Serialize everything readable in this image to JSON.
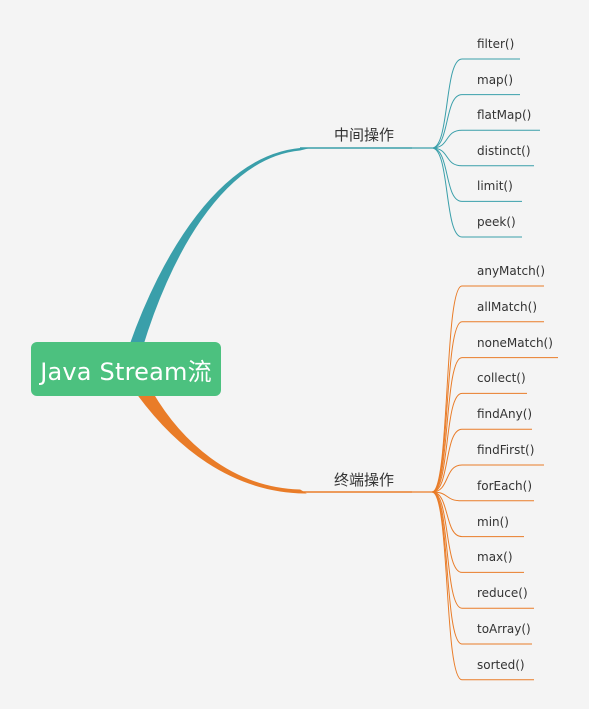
{
  "root": {
    "label": "Java Stream流"
  },
  "colors": {
    "root_bg": "#4cc17f",
    "intermediate": "#3a9faa",
    "terminal": "#e97c28"
  },
  "branches": [
    {
      "label": "中间操作",
      "color": "#3a9faa",
      "items": [
        "filter()",
        "map()",
        "flatMap()",
        "distinct()",
        "limit()",
        "peek()"
      ]
    },
    {
      "label": "终端操作",
      "color": "#e97c28",
      "items": [
        "anyMatch()",
        "allMatch()",
        "noneMatch()",
        "collect()",
        "findAny()",
        "findFirst()",
        "forEach()",
        "min()",
        "max()",
        "reduce()",
        "toArray()",
        "sorted()"
      ]
    }
  ]
}
